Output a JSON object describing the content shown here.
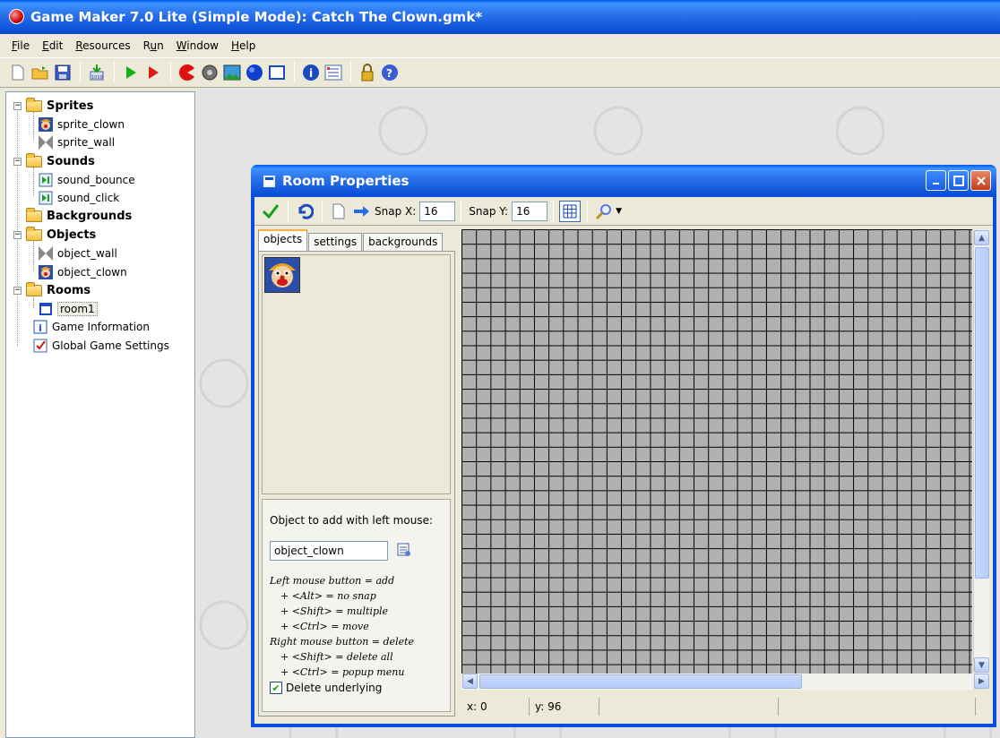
{
  "window": {
    "title": "Game Maker 7.0 Lite (Simple Mode): Catch The Clown.gmk*"
  },
  "menu": [
    {
      "label": "File",
      "u": "F"
    },
    {
      "label": "Edit",
      "u": "E"
    },
    {
      "label": "Resources",
      "u": "R"
    },
    {
      "label": "Run",
      "u": "u"
    },
    {
      "label": "Window",
      "u": "W"
    },
    {
      "label": "Help",
      "u": "H"
    }
  ],
  "toolbar_icons": [
    "new-file-icon",
    "open-folder-icon",
    "save-icon",
    "create-executable-icon",
    "run-icon",
    "debug-run-icon",
    "sprite-icon",
    "sound-icon",
    "background-icon",
    "object-icon",
    "room-icon",
    "game-info-icon",
    "global-settings-icon",
    "advanced-mode-icon",
    "help-icon"
  ],
  "tree": {
    "sprites": "Sprites",
    "sprite_clown": "sprite_clown",
    "sprite_wall": "sprite_wall",
    "sounds": "Sounds",
    "sound_bounce": "sound_bounce",
    "sound_click": "sound_click",
    "backgrounds": "Backgrounds",
    "objects": "Objects",
    "object_wall": "object_wall",
    "object_clown": "object_clown",
    "rooms": "Rooms",
    "room1": "room1",
    "game_info": "Game Information",
    "global_settings": "Global Game Settings"
  },
  "room": {
    "title": "Room Properties",
    "snap_x_label": "Snap X:",
    "snap_x": "16",
    "snap_y_label": "Snap Y:",
    "snap_y": "16",
    "tabs": [
      "objects",
      "settings",
      "backgrounds"
    ],
    "object_to_add_label": "Object to add with left mouse:",
    "object_to_add": "object_clown",
    "help_lines": [
      "Left mouse button = add",
      "+ <Alt> = no snap",
      "+ <Shift> = multiple",
      "+ <Ctrl> = move",
      "Right mouse button = delete",
      "+ <Shift> = delete all",
      "+ <Ctrl> = popup menu"
    ],
    "delete_underlying": "Delete underlying",
    "status_x": "x: 0",
    "status_y": "y: 96"
  },
  "colors": {
    "title_blue": "#0a50d8",
    "grid_fill": "#b0b0b0",
    "xp_face": "#ece9d8"
  }
}
